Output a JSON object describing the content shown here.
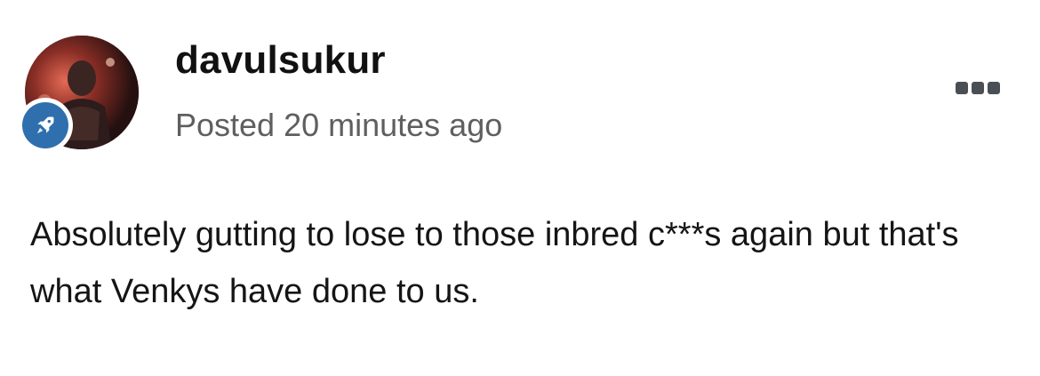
{
  "post": {
    "author": {
      "username": "davulsukur",
      "avatar": "user-avatar-photo",
      "badge_icon": "rocket-icon"
    },
    "meta": {
      "posted_text": "Posted 20 minutes ago"
    },
    "menu_icon": "more-options-icon",
    "content": {
      "text": "Absolutely gutting to lose to those inbred c***s again but that's what Venkys have done to us."
    }
  },
  "colors": {
    "badge_background": "#2f6fad",
    "username": "#111111",
    "meta_text": "#5f5f5f",
    "menu_dots": "#4a4e55"
  }
}
